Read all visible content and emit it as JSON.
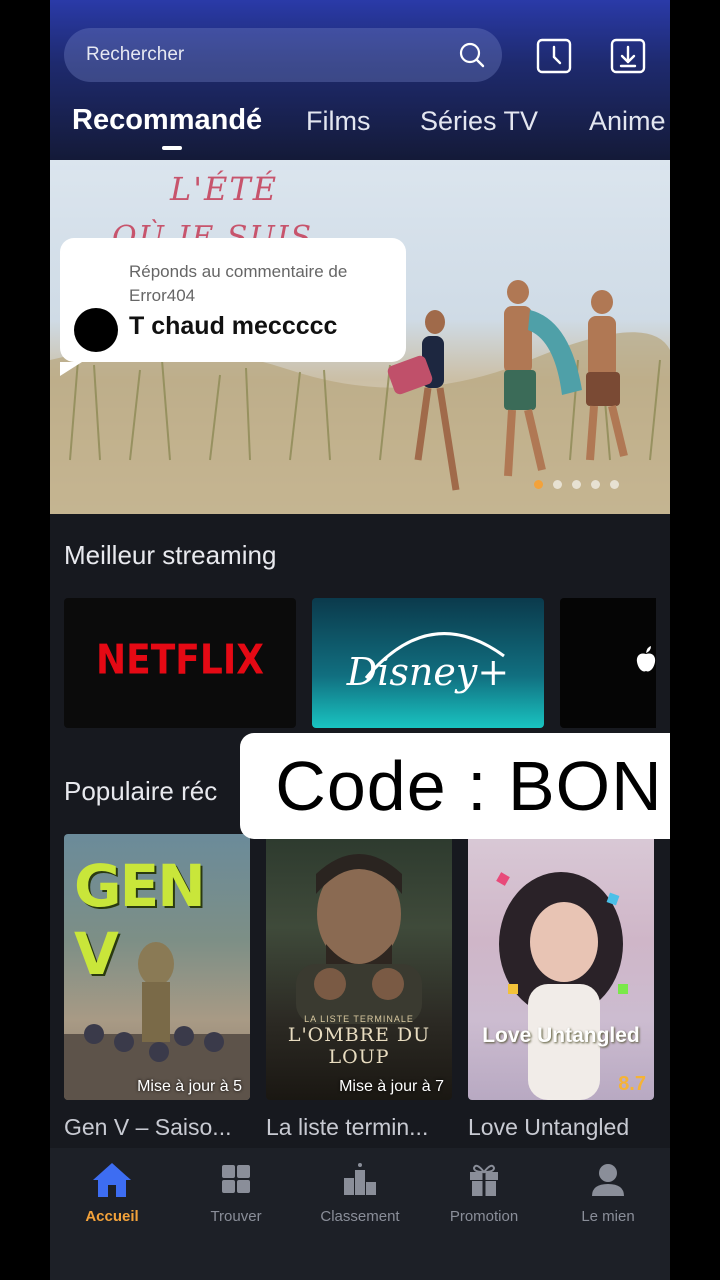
{
  "header": {
    "search_placeholder": "Rechercher",
    "icons": [
      "search-icon",
      "history-icon",
      "download-icon"
    ]
  },
  "tabs": [
    {
      "label": "Recommandé",
      "active": true
    },
    {
      "label": "Films",
      "active": false
    },
    {
      "label": "Séries TV",
      "active": false
    },
    {
      "label": "Anime",
      "active": false
    }
  ],
  "banner": {
    "title_line1": "L'ÉTÉ",
    "title_line2": "OÙ JE SUIS",
    "slide_count": 5,
    "active_slide": 1
  },
  "comment": {
    "subtitle": "Réponds au commentaire de Error404",
    "text": "T chaud meccccc"
  },
  "sections": {
    "streaming_title": "Meilleur streaming",
    "popular_title": "Populaire réc"
  },
  "streaming": [
    {
      "name": "NETFLIX"
    },
    {
      "name": "Disney+"
    },
    {
      "name": "apple"
    }
  ],
  "overlay": {
    "code": "Code : BON"
  },
  "posters": [
    {
      "art_title": "GEN V",
      "badge": "Mise à jour à 5",
      "caption": "Gen V – Saiso..."
    },
    {
      "art_subtitle": "LA LISTE TERMINALE",
      "art_title": "L'OMBRE DU LOUP",
      "badge": "Mise à jour à 7",
      "caption": "La liste termin..."
    },
    {
      "art_title": "Love Untangled",
      "rating": "8.7",
      "caption": "Love Untangled"
    }
  ],
  "bottom_nav": [
    {
      "label": "Accueil",
      "icon": "home-icon",
      "active": true
    },
    {
      "label": "Trouver",
      "icon": "grid-icon",
      "active": false
    },
    {
      "label": "Classement",
      "icon": "ranking-icon",
      "active": false
    },
    {
      "label": "Promotion",
      "icon": "gift-icon",
      "active": false
    },
    {
      "label": "Le mien",
      "icon": "user-icon",
      "active": false
    }
  ],
  "colors": {
    "accent": "#f3a23a",
    "nav_active_icon": "#3d6df2",
    "header_top": "#2a3aa8"
  }
}
